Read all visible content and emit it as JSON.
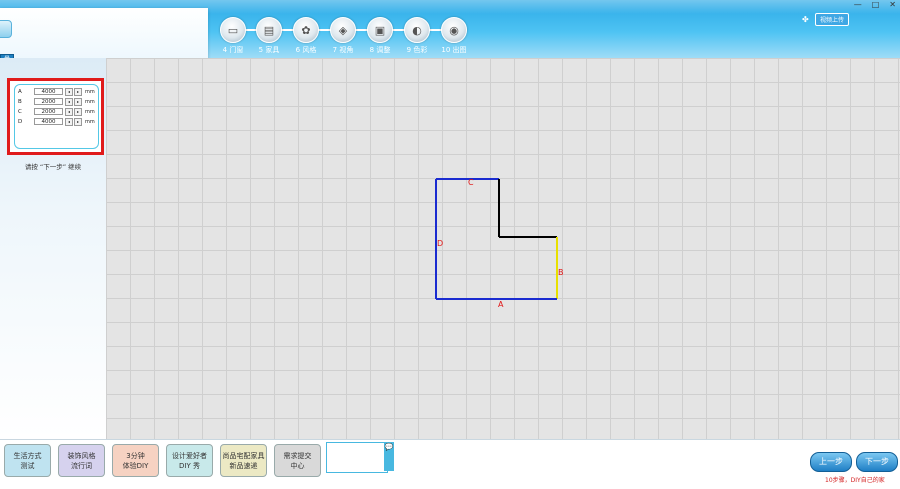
{
  "window": {
    "controls": [
      "—",
      "□",
      "✕"
    ]
  },
  "header": {
    "logo_tab_label": "量",
    "upload_button": "视频上传",
    "steps": [
      {
        "label": "4 门窗",
        "icon": "door-window-icon"
      },
      {
        "label": "5 家具",
        "icon": "furniture-icon"
      },
      {
        "label": "6 风格",
        "icon": "style-icon"
      },
      {
        "label": "7 视角",
        "icon": "view-angle-icon"
      },
      {
        "label": "8 调整",
        "icon": "adjust-icon"
      },
      {
        "label": "9 色彩",
        "icon": "color-icon"
      },
      {
        "label": "10 出图",
        "icon": "render-icon"
      }
    ]
  },
  "dimensions": {
    "unit": "mm",
    "rows": [
      {
        "key": "A",
        "value": "4000"
      },
      {
        "key": "B",
        "value": "2000"
      },
      {
        "key": "C",
        "value": "2000"
      },
      {
        "key": "D",
        "value": "4000"
      }
    ],
    "hint": "请按 “下一步” 继续"
  },
  "floorplan": {
    "labels": {
      "A": "A",
      "B": "B",
      "C": "C",
      "D": "D"
    },
    "colors": {
      "blue": "#1a2bd0",
      "black": "#000000",
      "yellow": "#e8e000",
      "label": "#e01515"
    }
  },
  "bottom": {
    "buttons": [
      {
        "label": "生活方式\n测试",
        "color": "#bfe3f0"
      },
      {
        "label": "装饰风格\n流行词",
        "color": "#d6d2ee"
      },
      {
        "label": "3分钟\n体验DIY",
        "color": "#f6d2c2"
      },
      {
        "label": "设计爱好者\nDIY 秀",
        "color": "#c8e9ea"
      },
      {
        "label": "尚品宅配家具\n新品速递",
        "color": "#ece9c4"
      },
      {
        "label": "需求提交\n中心",
        "color": "#d9d9d9"
      }
    ],
    "chat_icon": "chat-bubble-icon",
    "prev": "上一步",
    "next": "下一步",
    "note": "10步骤，DIY自己的家"
  }
}
